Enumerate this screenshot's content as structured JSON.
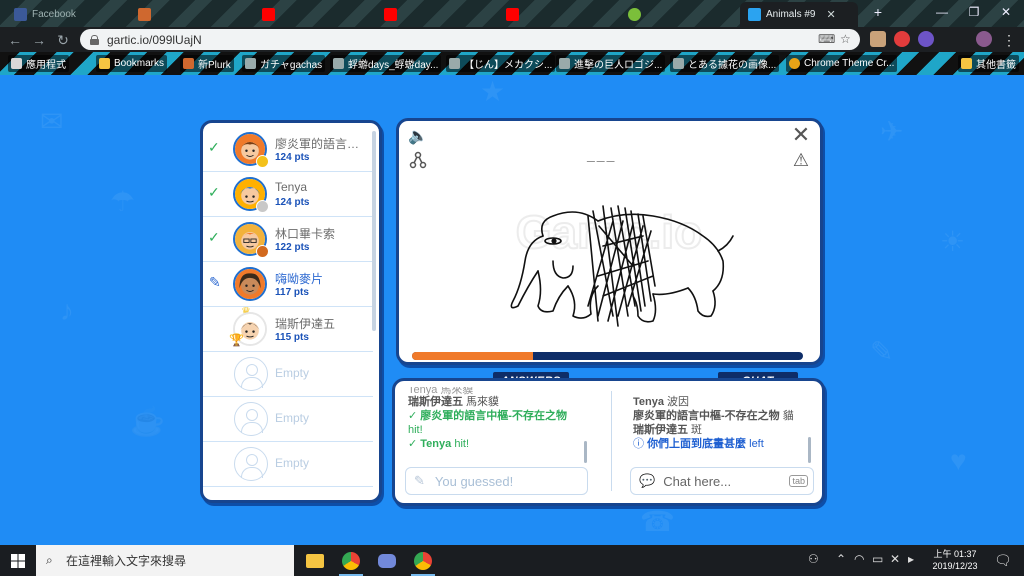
{
  "browser": {
    "tabs": [
      {
        "label": "Facebook",
        "icon": "facebook-icon",
        "color": "#3b5998"
      },
      {
        "label": "",
        "icon": "plurk-icon",
        "color": "#cf682f"
      },
      {
        "label": "",
        "icon": "youtube-icon",
        "color": "#ff0000"
      },
      {
        "label": "",
        "icon": "youtube-icon",
        "color": "#ff0000"
      },
      {
        "label": "",
        "icon": "youtube-icon",
        "color": "#ff0000"
      },
      {
        "label": "",
        "icon": "tab-icon",
        "color": "#7bbf3a"
      },
      {
        "label": "Animals #9",
        "icon": "gartic-icon",
        "color": "#2ba3f0"
      }
    ],
    "url": "gartic.io/099lUajN",
    "bookmarks": [
      {
        "label": "應用程式",
        "icon": "apps-icon"
      },
      {
        "label": "Bookmarks",
        "icon": "folder-icon"
      },
      {
        "label": "新Plurk",
        "icon": "plurk-icon"
      },
      {
        "label": "ガチャgachas",
        "icon": "page-icon"
      },
      {
        "label": "蜉蝣days_蜉蝣day...",
        "icon": "page-icon"
      },
      {
        "label": "【じん】メカクシ...",
        "icon": "page-icon"
      },
      {
        "label": "進擊の巨人ロゴジ...",
        "icon": "page-icon"
      },
      {
        "label": "とある據花の画像...",
        "icon": "page-icon"
      },
      {
        "label": "Chrome Theme Cr...",
        "icon": "chrome-icon"
      },
      {
        "label": "其他書籤",
        "icon": "folder-icon"
      }
    ]
  },
  "players": [
    {
      "name": "廖炎軍的語言中樞-不存在之物",
      "pts": "124 pts",
      "status": "guessed",
      "medal": "#f3c11b",
      "avatar_bg": "#f07a2a",
      "hair": "#7a3d12"
    },
    {
      "name": "Tenya",
      "pts": "124 pts",
      "status": "guessed",
      "medal": "#c8c8c8",
      "avatar_bg": "#ffb000",
      "hair": "#2a7bd6"
    },
    {
      "name": "林口畢卡索",
      "pts": "122 pts",
      "status": "guessed",
      "medal": "#d2691e",
      "avatar_bg": "#f2b23b",
      "hair": "#f07a2a"
    },
    {
      "name": "嗨呦麥片",
      "pts": "117 pts",
      "status": "drawing",
      "medal": "",
      "avatar_bg": "#f07a2a",
      "hair": "#3a2a1a"
    },
    {
      "name": "瑞斯伊達五",
      "pts": "115 pts",
      "status": "host",
      "medal": "",
      "avatar_bg": "#ffffff",
      "hair": "#222222"
    }
  ],
  "empty_slots": [
    "Empty",
    "Empty",
    "Empty"
  ],
  "canvas": {
    "word_hint": "___",
    "timer_fraction": 0.31,
    "watermark": "Gartic.io"
  },
  "labels": {
    "answers": "ANSWERS",
    "chat": "CHAT"
  },
  "answers": {
    "top_partial": "Tenya 馬來貘",
    "messages": [
      {
        "type": "guess",
        "who": "瑞斯伊達五",
        "text": " 馬來貘"
      },
      {
        "type": "hit",
        "who": "廖炎軍的語言中樞-不存在之物",
        "text": "hit!"
      },
      {
        "type": "hit",
        "who": "Tenya",
        "text": " hit!"
      }
    ],
    "input_placeholder": "You guessed!"
  },
  "chat": {
    "top_partial": "",
    "messages": [
      {
        "type": "chat",
        "who": "Tenya",
        "text": " 波因"
      },
      {
        "type": "chat",
        "who": "廖炎軍的語言中樞-不存在之物",
        "text": " 貓"
      },
      {
        "type": "chat",
        "who": "瑞斯伊達五",
        "text": " 斑"
      },
      {
        "type": "info",
        "who": "你們上面到底畫甚麼",
        "text": " left"
      }
    ],
    "input_placeholder": "Chat here...",
    "tab_hint": "tab"
  },
  "taskbar": {
    "search_placeholder": "在這裡輸入文字來搜尋",
    "time": "上午 01:37",
    "date": "2019/12/23"
  }
}
